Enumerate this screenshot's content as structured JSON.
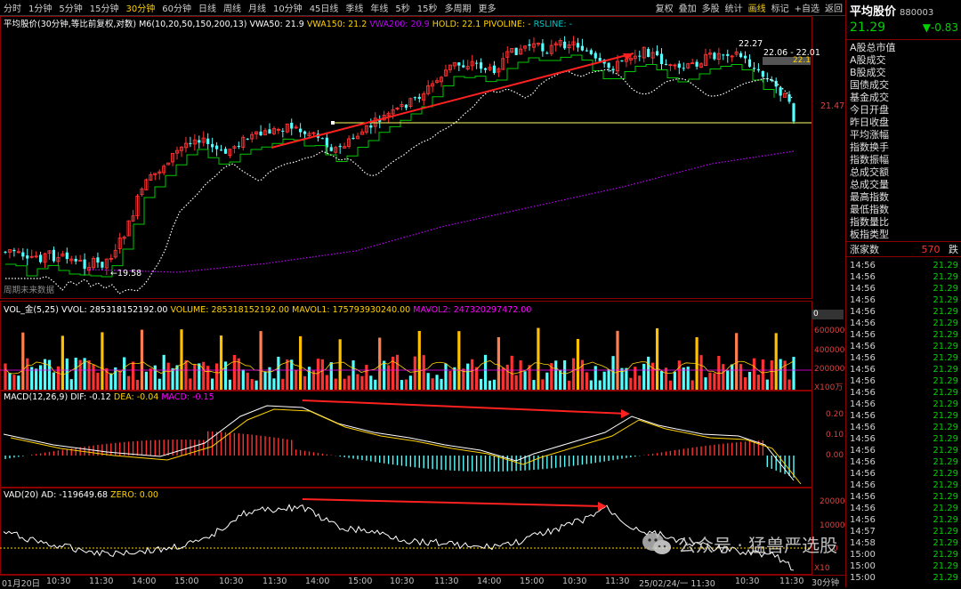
{
  "toolbar": {
    "items": [
      "分时",
      "1分钟",
      "5分钟",
      "15分钟",
      "30分钟",
      "60分钟",
      "日线",
      "周线",
      "月线",
      "10分钟",
      "45日线",
      "季线",
      "年线",
      "5秒",
      "15秒",
      "多周期",
      "更多"
    ],
    "active_index": 4,
    "right_items": [
      "复权",
      "叠加",
      "多股",
      "统计",
      "画线",
      "标记",
      "+自选",
      "返回"
    ],
    "right_active_index": 4
  },
  "main_legend": {
    "name": "平均股价(30分钟,等比前复权,对数)",
    "ma": "M6(10,20,50,150,200,13)",
    "vwa50": "VWA50: 21.9",
    "vwa150": "VWA150: 21.2",
    "vwa200": "VWA200: 20.9",
    "hold": "HOLD: 22.1",
    "pivoline": "PIVOLINE: -",
    "rsline": "RSLINE: -"
  },
  "main_annotations": {
    "high_label": "22.27",
    "range_label": "22.06 - 22.01",
    "price_tag": "22.1",
    "level_label": "21.47",
    "low_label": "19.58",
    "bottom_note": "周期未来数据"
  },
  "vol_legend": {
    "name": "VOL_金(5,25)",
    "vvol": "VVOL: 285318152192.00",
    "volume": "VOLUME: 285318152192.00",
    "mavol1": "MAVOL1: 175793930240.00",
    "mavol2": "MAVOL2: 247320297472.00"
  },
  "vol_axis": [
    "0",
    "600000",
    "400000",
    "200000",
    "X100万"
  ],
  "macd_legend": {
    "name": "MACD(12,26,9)",
    "dif": "DIF: -0.12",
    "dea": "DEA: -0.04",
    "macd": "MACD: -0.15"
  },
  "macd_axis": [
    "0.20",
    "0.10",
    "0.00"
  ],
  "vad_legend": {
    "name": "VAD(20)",
    "ad": "AD: -119649.68",
    "zero": "ZERO: 0.00"
  },
  "vad_axis": [
    "20000",
    "10000",
    "0",
    "X10"
  ],
  "x_axis": [
    "01月20日",
    "10:30",
    "11:30",
    "14:00",
    "15:00",
    "10:30",
    "11:30",
    "14:00",
    "15:00",
    "10:30",
    "11:30",
    "14:00",
    "15:00",
    "10:30",
    "11:30",
    "25/02/24/一 11:30",
    "10:30",
    "11:30"
  ],
  "period_label": "30分钟",
  "watermark": "公众号 · 猛兽严选股",
  "right_panel": {
    "name": "平均股价",
    "code": "880003",
    "price": "21.29",
    "change": "▼-0.83",
    "menu": [
      "A股总市值",
      "A股成交",
      "B股成交",
      "国债成交",
      "基金成交",
      "今日开盘",
      "昨日收盘",
      "平均涨幅",
      "指数换手",
      "指数振幅",
      "总成交额",
      "总成交量",
      "最高指数",
      "最低指数",
      "指数量比",
      "板指类型"
    ],
    "stat_label": "涨家数",
    "stat_value": "570",
    "stat_label2": "跌",
    "ticks": [
      {
        "t": "14:56",
        "p": "21.29"
      },
      {
        "t": "14:56",
        "p": "21.29"
      },
      {
        "t": "14:56",
        "p": "21.29"
      },
      {
        "t": "14:56",
        "p": "21.29"
      },
      {
        "t": "14:56",
        "p": "21.29"
      },
      {
        "t": "14:56",
        "p": "21.29"
      },
      {
        "t": "14:56",
        "p": "21.29"
      },
      {
        "t": "14:56",
        "p": "21.29"
      },
      {
        "t": "14:56",
        "p": "21.29"
      },
      {
        "t": "14:56",
        "p": "21.29"
      },
      {
        "t": "14:56",
        "p": "21.29"
      },
      {
        "t": "14:56",
        "p": "21.29"
      },
      {
        "t": "14:56",
        "p": "21.29"
      },
      {
        "t": "14:56",
        "p": "21.29"
      },
      {
        "t": "14:56",
        "p": "21.29"
      },
      {
        "t": "14:56",
        "p": "21.29"
      },
      {
        "t": "14:56",
        "p": "21.29"
      },
      {
        "t": "14:56",
        "p": "21.29"
      },
      {
        "t": "14:56",
        "p": "21.29"
      },
      {
        "t": "14:56",
        "p": "21.29"
      },
      {
        "t": "14:56",
        "p": "21.29"
      },
      {
        "t": "14:56",
        "p": "21.29"
      },
      {
        "t": "14:56",
        "p": "21.29"
      },
      {
        "t": "14:57",
        "p": "21.29"
      },
      {
        "t": "14:58",
        "p": "21.29"
      },
      {
        "t": "15:00",
        "p": "21.29"
      },
      {
        "t": "15:00",
        "p": "21.29"
      },
      {
        "t": "15:00",
        "p": "21.29"
      }
    ]
  },
  "colors": {
    "up": "#ff3232",
    "down": "#54ffff",
    "hold": "#00c800",
    "vwa50": "#ffffff",
    "vwa200": "#c000ff",
    "vol_gold": "#ffc000",
    "vol_orange": "#ff7f50",
    "arrow": "#ff2020",
    "border": "#8b0000"
  }
}
